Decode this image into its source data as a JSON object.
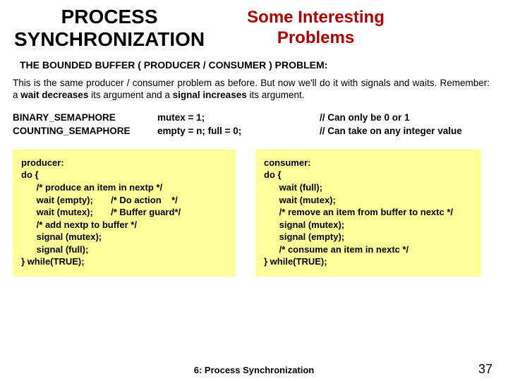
{
  "header": {
    "left_line1": "PROCESS",
    "left_line2": "SYNCHRONIZATION",
    "right_line1": "Some Interesting",
    "right_line2": "Problems"
  },
  "problem_heading": "THE BOUNDED BUFFER ( PRODUCER / CONSUMER ) PROBLEM:",
  "intro_html": "This is the same producer / consumer problem as before. But now we'll do it with signals and waits. Remember: a <b>wait decreases</b> its argument and a <b>signal increases</b> its argument.",
  "sem": {
    "row1": {
      "type": "BINARY_SEMAPHORE",
      "init": "mutex = 1;",
      "comment": "// Can only be 0 or 1"
    },
    "row2": {
      "type": "COUNTING_SEMAPHORE",
      "init": "empty = n;   full = 0;",
      "comment": "// Can take on any integer value"
    }
  },
  "producer_code": "producer:\ndo {\n      /* produce an item in nextp */\n      wait (empty);       /* Do action    */\n      wait (mutex);       /* Buffer guard*/\n      /* add nextp to buffer */\n      signal (mutex);\n      signal (full);\n} while(TRUE);",
  "consumer_code": "consumer:\ndo {\n      wait (full);\n      wait (mutex);\n      /* remove an item from buffer to nextc */\n      signal (mutex);\n      signal (empty);\n      /* consume an item in nextc */\n} while(TRUE);",
  "footer_text": "6: Process Synchronization",
  "page_number": "37"
}
